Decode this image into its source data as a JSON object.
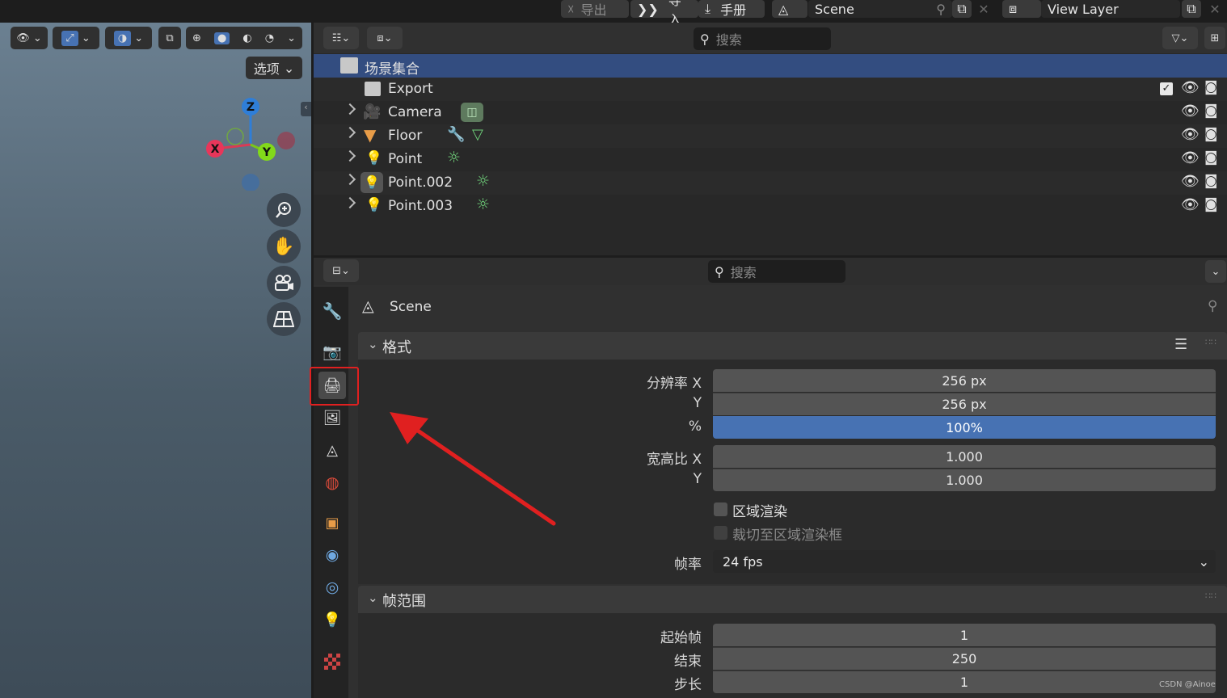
{
  "topbar": {
    "export_label": "导出",
    "import_label": "导入",
    "manual_label": "手册",
    "scene_name": "Scene",
    "view_layer_name": "View Layer"
  },
  "viewport": {
    "options_label": "选项",
    "gizmo": {
      "z": "Z",
      "x": "X",
      "y": "Y"
    }
  },
  "outliner": {
    "search_placeholder": "搜索",
    "collection_label": "场景集合",
    "items": [
      {
        "name": "Export",
        "icon": "collection-icon"
      },
      {
        "name": "Camera",
        "icon": "camera-icon"
      },
      {
        "name": "Floor",
        "icon": "mesh-icon"
      },
      {
        "name": "Point",
        "icon": "light-icon"
      },
      {
        "name": "Point.002",
        "icon": "light-icon"
      },
      {
        "name": "Point.003",
        "icon": "light-icon"
      }
    ]
  },
  "properties": {
    "search_placeholder": "搜索",
    "context_title": "Scene",
    "format": {
      "panel_title": "格式",
      "resolution_x_label": "分辨率 X",
      "resolution_x": "256 px",
      "resolution_y_label": "Y",
      "resolution_y": "256 px",
      "percent_label": "%",
      "percent": "100%",
      "aspect_x_label": "宽高比 X",
      "aspect_x": "1.000",
      "aspect_y_label": "Y",
      "aspect_y": "1.000",
      "region_render_label": "区域渲染",
      "crop_label": "裁切至区域渲染框",
      "fps_label": "帧率",
      "fps": "24 fps"
    },
    "frame_range": {
      "panel_title": "帧范围",
      "start_label": "起始帧",
      "start": "1",
      "end_label": "结束",
      "end": "250",
      "step_label": "步长",
      "step": "1"
    }
  },
  "watermark": "CSDN @Ainoe",
  "colors": {
    "accent": "#4772b3",
    "highlight": "#e02020",
    "selected_row": "#334d80"
  }
}
